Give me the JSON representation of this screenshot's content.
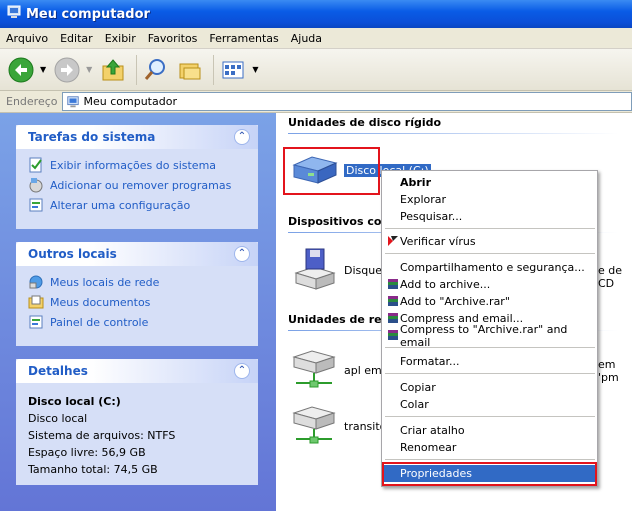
{
  "window": {
    "title": "Meu computador"
  },
  "menu": [
    "Arquivo",
    "Editar",
    "Exibir",
    "Favoritos",
    "Ferramentas",
    "Ajuda"
  ],
  "toolbar": {
    "icons": [
      "back-icon",
      "forward-icon",
      "up-folder-icon",
      "search-icon",
      "folders-icon",
      "views-icon"
    ]
  },
  "address": {
    "label": "Endereço",
    "value": "Meu computador"
  },
  "left": {
    "system_tasks": {
      "title": "Tarefas do sistema",
      "items": [
        "Exibir informações do sistema",
        "Adicionar ou remover programas",
        "Alterar uma configuração"
      ]
    },
    "other_places": {
      "title": "Outros locais",
      "items": [
        "Meus locais de rede",
        "Meus documentos",
        "Painel de controle"
      ]
    },
    "details": {
      "title": "Detalhes",
      "name": "Disco local (C:)",
      "type": "Disco local",
      "fs": "Sistema de arquivos: NTFS",
      "free": "Espaço livre: 56,9 GB",
      "total": "Tamanho total: 74,5 GB"
    }
  },
  "main": {
    "group_hdd": "Unidades de disco rígido",
    "hdd_label": "Disco local (C:)",
    "group_removable": "Dispositivos com armazenamento removível",
    "floppy_label": "Disquete de 3½ (A:)",
    "cd_label_fragment": "e de CD",
    "group_network": "Unidades de rede",
    "net1_label": "apl em '",
    "net1_fragment": "em 'pm",
    "net2_label": "transito"
  },
  "context_menu": {
    "items": [
      "Abrir",
      "Explorar",
      "Pesquisar...",
      "Verificar vírus",
      "Compartilhamento e segurança...",
      "Add to archive...",
      "Add to \"Archive.rar\"",
      "Compress and email...",
      "Compress to \"Archive.rar\" and email",
      "Formatar...",
      "Copiar",
      "Colar",
      "Criar atalho",
      "Renomear",
      "Propriedades"
    ]
  },
  "colors": {
    "highlight": "#316ac5",
    "annotation_red": "#e3141c",
    "link": "#215dc6"
  }
}
